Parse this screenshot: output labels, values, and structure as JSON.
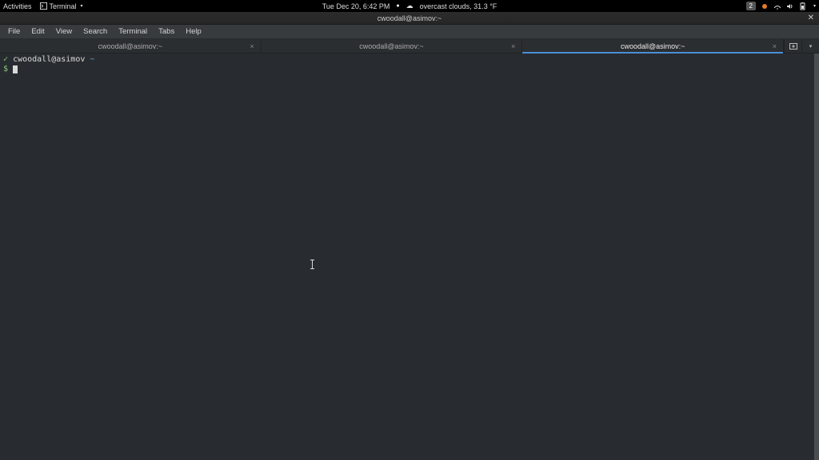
{
  "topbar": {
    "activities": "Activities",
    "app_name": "Terminal",
    "datetime": "Tue Dec 20,  6:42 PM",
    "weather": "overcast clouds, 31.3 °F",
    "workspace": "2"
  },
  "window": {
    "title": "cwoodall@asimov:~"
  },
  "menubar": {
    "items": [
      "File",
      "Edit",
      "View",
      "Search",
      "Terminal",
      "Tabs",
      "Help"
    ]
  },
  "tabs": {
    "items": [
      {
        "label": "cwoodall@asimov:~",
        "active": false
      },
      {
        "label": "cwoodall@asimov:~",
        "active": false
      },
      {
        "label": "cwoodall@asimov:~",
        "active": true
      }
    ]
  },
  "terminal": {
    "line1_sym": "✓",
    "line1_userhost": "cwoodall@asimov",
    "line1_path": "~",
    "line2_sym": "$"
  }
}
